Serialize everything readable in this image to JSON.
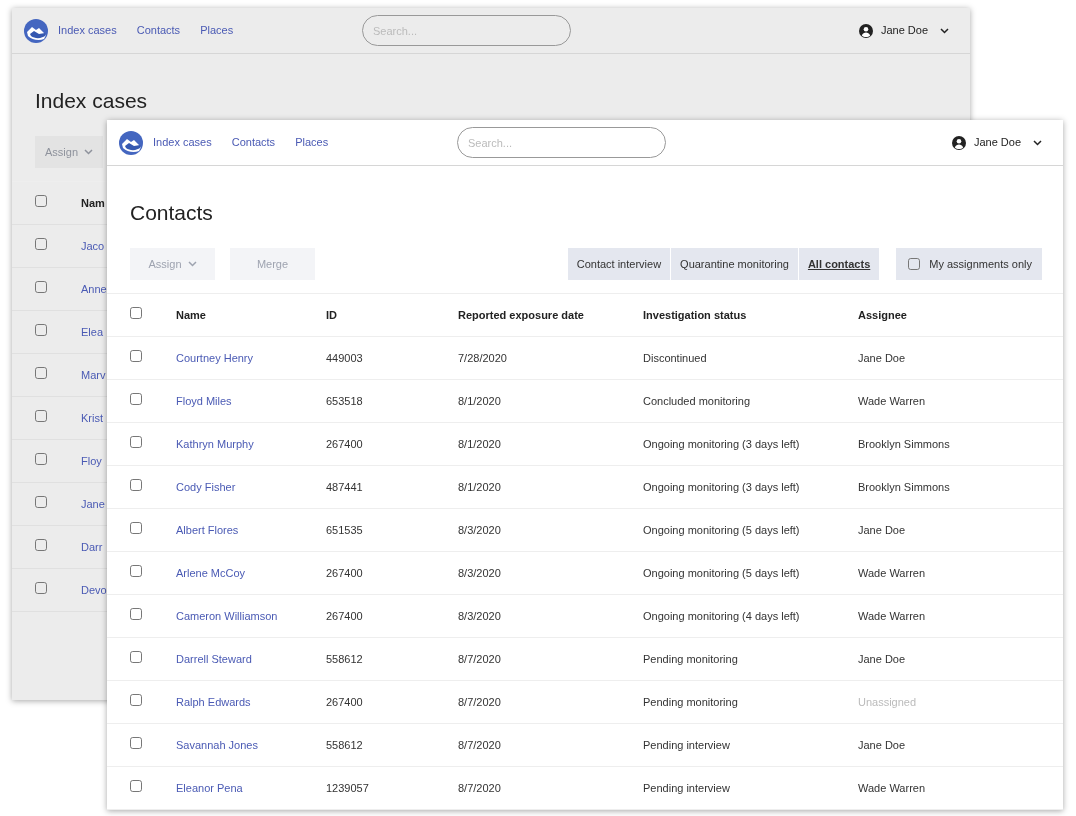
{
  "back_window": {
    "nav": {
      "links": [
        "Index cases",
        "Contacts",
        "Places"
      ],
      "search": {
        "placeholder": "Search..."
      },
      "user": "Jane Doe"
    },
    "title": "Index cases",
    "toolbar": {
      "buttons": [
        {
          "label": "Assign",
          "dropdown": true,
          "disabled": true
        }
      ]
    },
    "table": {
      "all_checked": false,
      "columns": [
        "Nam"
      ],
      "rows": [
        {
          "checked": false,
          "cells": [
            "Jaco"
          ]
        },
        {
          "checked": false,
          "cells": [
            "Anne"
          ]
        },
        {
          "checked": false,
          "cells": [
            "Elea"
          ]
        },
        {
          "checked": false,
          "cells": [
            "Marv"
          ]
        },
        {
          "checked": false,
          "cells": [
            "Krist"
          ]
        },
        {
          "checked": false,
          "cells": [
            "Floy"
          ]
        },
        {
          "checked": false,
          "cells": [
            "Jane"
          ]
        },
        {
          "checked": false,
          "cells": [
            "Darr"
          ]
        },
        {
          "checked": false,
          "cells": [
            "Devo"
          ]
        }
      ]
    }
  },
  "front_window": {
    "nav": {
      "links": [
        "Index cases",
        "Contacts",
        "Places"
      ],
      "search": {
        "placeholder": "Search..."
      },
      "user": "Jane Doe"
    },
    "title": "Contacts",
    "toolbar": {
      "buttons": [
        {
          "label": "Assign",
          "dropdown": true,
          "disabled": true
        },
        {
          "label": "Merge",
          "dropdown": false,
          "disabled": true
        }
      ],
      "filters": [
        {
          "label": "Contact interview",
          "selected": false
        },
        {
          "label": "Quarantine monitoring",
          "selected": false
        },
        {
          "label": "All contacts",
          "selected": true
        }
      ],
      "my_assignments": {
        "label": "My assignments only",
        "checked": false
      }
    },
    "table": {
      "all_checked": false,
      "columns": [
        "Name",
        "ID",
        "Reported exposure date",
        "Investigation status",
        "Assignee"
      ],
      "rows": [
        {
          "checked": false,
          "assigned": true,
          "cells": [
            "Courtney Henry",
            "449003",
            "7/28/2020",
            "Discontinued",
            "Jane Doe"
          ]
        },
        {
          "checked": false,
          "assigned": true,
          "cells": [
            "Floyd Miles",
            "653518",
            "8/1/2020",
            "Concluded monitoring",
            "Wade Warren"
          ]
        },
        {
          "checked": false,
          "assigned": true,
          "cells": [
            "Kathryn Murphy",
            "267400",
            "8/1/2020",
            "Ongoing monitoring (3 days left)",
            "Brooklyn Simmons"
          ]
        },
        {
          "checked": false,
          "assigned": true,
          "cells": [
            "Cody Fisher",
            "487441",
            "8/1/2020",
            "Ongoing monitoring (3 days left)",
            "Brooklyn Simmons"
          ]
        },
        {
          "checked": false,
          "assigned": true,
          "cells": [
            "Albert Flores",
            "651535",
            "8/3/2020",
            "Ongoing monitoring (5 days left)",
            "Jane Doe"
          ]
        },
        {
          "checked": false,
          "assigned": true,
          "cells": [
            "Arlene McCoy",
            "267400",
            "8/3/2020",
            "Ongoing monitoring (5 days left)",
            "Wade Warren"
          ]
        },
        {
          "checked": false,
          "assigned": true,
          "cells": [
            "Cameron Williamson",
            "267400",
            "8/3/2020",
            "Ongoing monitoring (4 days left)",
            "Wade Warren"
          ]
        },
        {
          "checked": false,
          "assigned": true,
          "cells": [
            "Darrell Steward",
            "558612",
            "8/7/2020",
            "Pending monitoring",
            "Jane Doe"
          ]
        },
        {
          "checked": false,
          "assigned": false,
          "cells": [
            "Ralph Edwards",
            "267400",
            "8/7/2020",
            "Pending monitoring",
            "Unassigned"
          ]
        },
        {
          "checked": false,
          "assigned": true,
          "cells": [
            "Savannah Jones",
            "558612",
            "8/7/2020",
            "Pending interview",
            "Jane Doe"
          ]
        },
        {
          "checked": false,
          "assigned": true,
          "cells": [
            "Eleanor Pena",
            "1239057",
            "8/7/2020",
            "Pending interview",
            "Wade Warren"
          ]
        }
      ]
    }
  }
}
